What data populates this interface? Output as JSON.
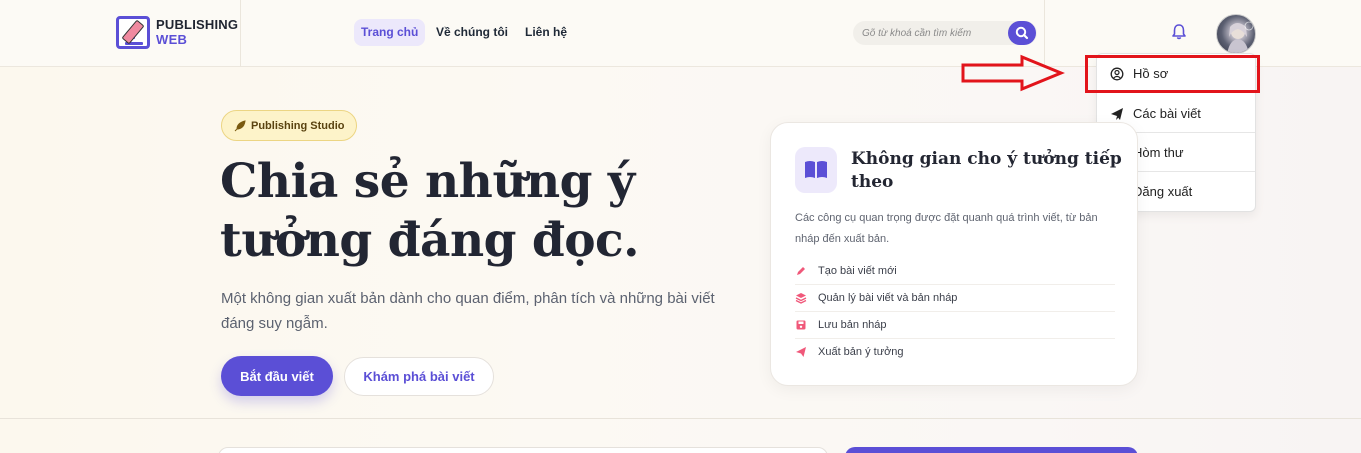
{
  "header": {
    "logo_line1": "PUBLISHING",
    "logo_line2": "WEB",
    "nav": [
      {
        "label": "Trang chủ",
        "active": true
      },
      {
        "label": "Về chúng tôi",
        "active": false
      },
      {
        "label": "Liên hệ",
        "active": false
      }
    ],
    "search_placeholder": "Gõ từ khoá cần tìm kiếm",
    "accent_color": "#5b4fd6"
  },
  "user_menu": {
    "items": [
      {
        "label": "Hồ sơ",
        "icon": "user-circle-icon"
      },
      {
        "label": "Các bài viết",
        "icon": "paper-plane-icon"
      },
      {
        "label": "Hòm thư",
        "icon": "inbox-icon"
      },
      {
        "label": "Đăng xuất",
        "icon": "sign-out-icon"
      }
    ],
    "highlight_color": "#e2141b"
  },
  "hero": {
    "badge": "Publishing Studio",
    "title_line1": "Chia sẻ những ý",
    "title_line2": "tưởng đáng đọc.",
    "subtitle": "Một không gian xuất bản dành cho quan điểm, phân tích và những bài viết đáng suy ngẫm.",
    "primary_button": "Bắt đầu viết",
    "secondary_button": "Khám phá bài viết"
  },
  "card": {
    "title_line1": "Không gian cho ý tưởng tiếp",
    "title_line2": "theo",
    "description": "Các công cụ quan trọng được đặt quanh quá trình viết, từ bản nháp đến xuất bản.",
    "features": [
      {
        "label": "Tạo bài viết mới",
        "icon": "pen-icon"
      },
      {
        "label": "Quản lý bài viết và bản nháp",
        "icon": "layers-icon"
      },
      {
        "label": "Lưu bản nháp",
        "icon": "save-icon"
      },
      {
        "label": "Xuất bản ý tưởng",
        "icon": "paper-plane-icon"
      }
    ],
    "feature_icon_color": "#f0587a"
  }
}
